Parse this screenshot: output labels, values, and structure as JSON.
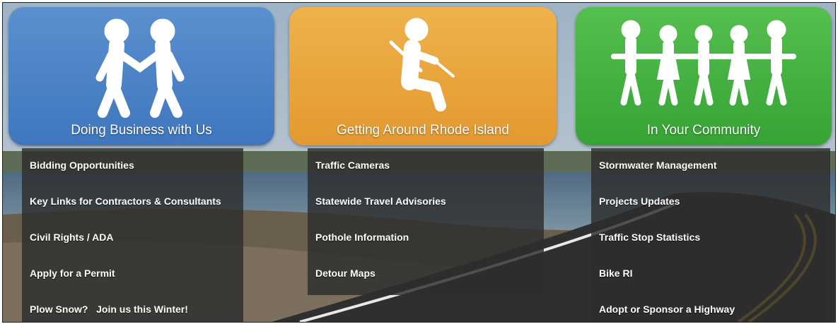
{
  "columns": [
    {
      "title": "Doing Business with Us",
      "icon": "two-people-walking-icon",
      "color": "#4a82c6",
      "links": [
        "Bidding Opportunities",
        "Key Links for Contractors & Consultants",
        "Civil Rights / ADA",
        "Apply for a Permit",
        "Plow Snow?   Join us this Winter!"
      ]
    },
    {
      "title": "Getting Around Rhode Island",
      "icon": "seatbelt-driver-icon",
      "color": "#e9a33b",
      "links": [
        "Traffic Cameras",
        "Statewide Travel Advisories",
        "Pothole Information",
        "Detour Maps"
      ]
    },
    {
      "title": "In Your Community",
      "icon": "community-people-icon",
      "color": "#44b040",
      "links": [
        "Stormwater Management",
        "Projects Updates",
        "Traffic Stop Statistics",
        "Bike RI",
        "Adopt or Sponsor a Highway"
      ]
    }
  ]
}
